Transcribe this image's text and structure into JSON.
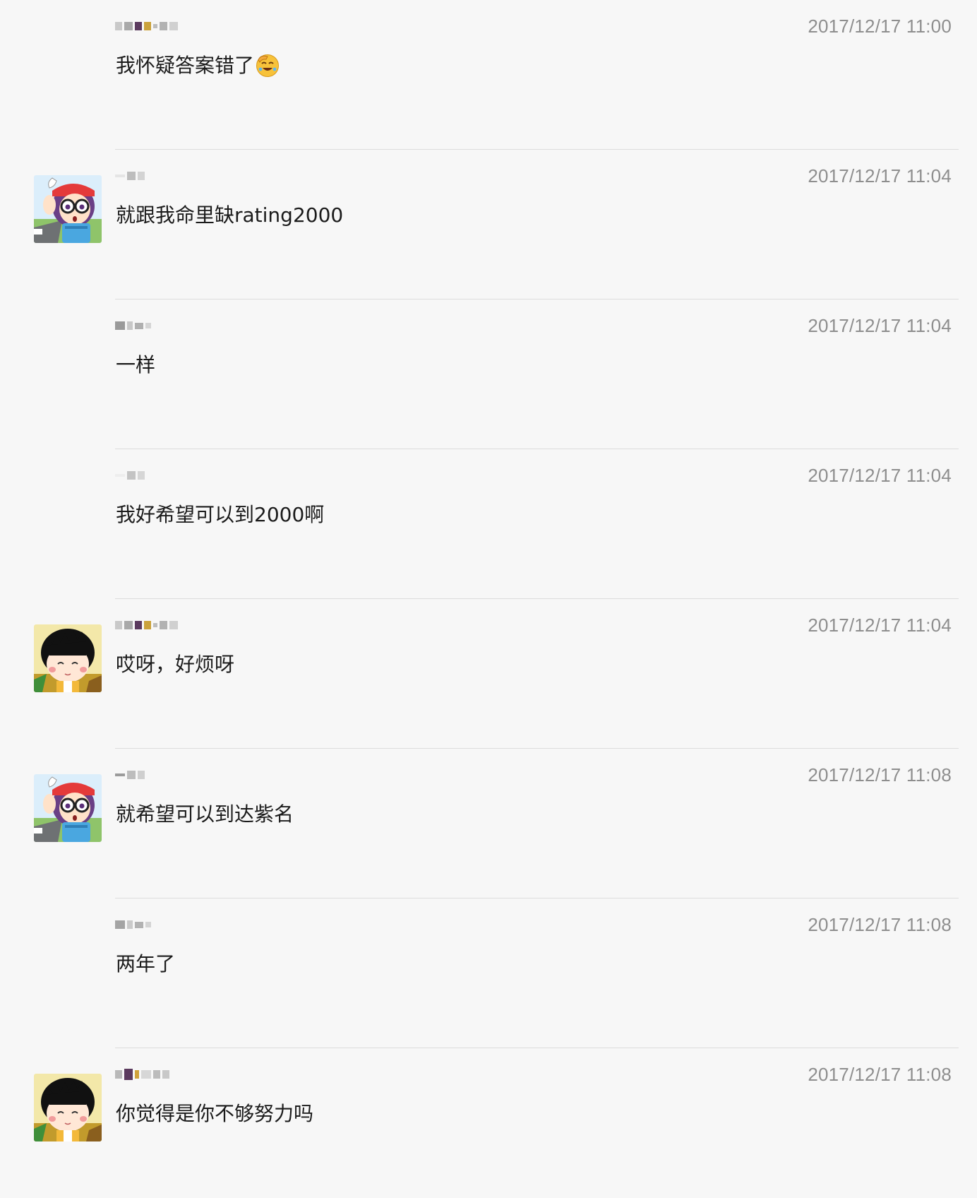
{
  "messages": [
    {
      "sender": "",
      "avatar": "none",
      "time": "2017/12/17 11:00",
      "text": "我怀疑答案错了",
      "emoji": "facepalm-laugh-emoji"
    },
    {
      "sender": "",
      "avatar": "arale-avatar",
      "time": "2017/12/17 11:04",
      "text": "就跟我命里缺rating2000",
      "emoji": ""
    },
    {
      "sender": "",
      "avatar": "none",
      "time": "2017/12/17 11:04",
      "text": "一样",
      "emoji": ""
    },
    {
      "sender": "",
      "avatar": "none",
      "time": "2017/12/17 11:04",
      "text": "我好希望可以到2000啊",
      "emoji": ""
    },
    {
      "sender": "",
      "avatar": "maruko-avatar",
      "time": "2017/12/17 11:04",
      "text": "哎呀，好烦呀",
      "emoji": ""
    },
    {
      "sender": "",
      "avatar": "arale-avatar",
      "time": "2017/12/17 11:08",
      "text": "就希望可以到达紫名",
      "emoji": ""
    },
    {
      "sender": "",
      "avatar": "none",
      "time": "2017/12/17 11:08",
      "text": "两年了",
      "emoji": ""
    },
    {
      "sender": "",
      "avatar": "maruko-avatar",
      "time": "2017/12/17 11:08",
      "text": "你觉得是你不够努力吗",
      "emoji": ""
    }
  ],
  "colors": {
    "background": "#f7f7f7",
    "divider": "#dcdcdc",
    "timestamp": "#8e8e8e",
    "text": "#1b1b1b"
  }
}
